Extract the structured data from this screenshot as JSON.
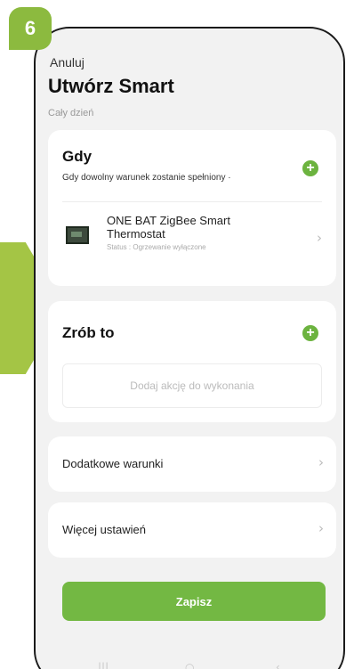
{
  "step_number": "6",
  "header": {
    "cancel_label": "Anuluj",
    "title": "Utwórz Smart",
    "subtitle": "Cały dzień"
  },
  "condition_card": {
    "title": "Gdy",
    "description": "Gdy dowolny warunek zostanie spełniony ·",
    "add_icon": "plus-circle-icon",
    "device": {
      "name_line1": "ONE BAT ZigBee Smart",
      "name_line2": "Thermostat",
      "status": "Status : Ogrzewanie wyłączone"
    }
  },
  "action_card": {
    "title": "Zrób to",
    "add_icon": "plus-circle-icon",
    "placeholder": "Dodaj akcję do wykonania"
  },
  "extra_conditions": {
    "label": "Dodatkowe warunki"
  },
  "more_settings": {
    "label": "Więcej ustawień"
  },
  "save_button": {
    "label": "Zapisz"
  },
  "colors": {
    "accent": "#73b843",
    "badge": "#8cba3f",
    "arrow": "#a4c545"
  }
}
